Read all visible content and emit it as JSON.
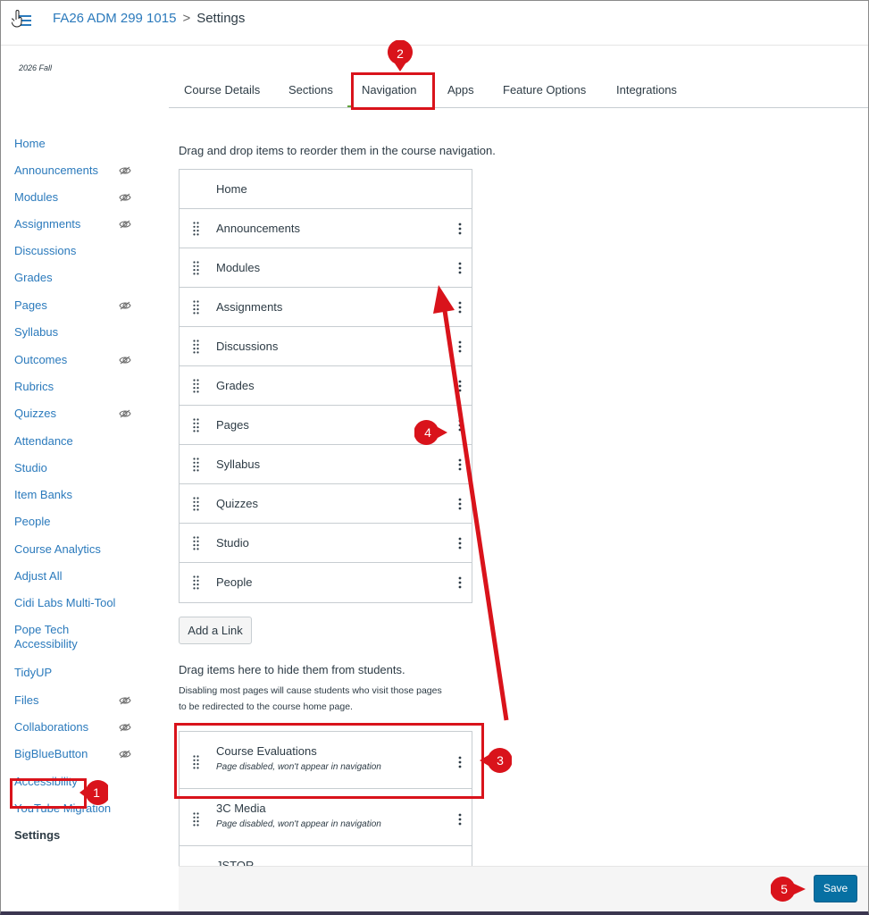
{
  "header": {
    "course": "FA26 ADM 299 1015",
    "separator": ">",
    "current": "Settings"
  },
  "sidebar": {
    "term": "2026 Fall",
    "items": [
      {
        "label": "Home",
        "hidden": false
      },
      {
        "label": "Announcements",
        "hidden": true
      },
      {
        "label": "Modules",
        "hidden": true
      },
      {
        "label": "Assignments",
        "hidden": true
      },
      {
        "label": "Discussions",
        "hidden": false
      },
      {
        "label": "Grades",
        "hidden": false
      },
      {
        "label": "Pages",
        "hidden": true
      },
      {
        "label": "Syllabus",
        "hidden": false
      },
      {
        "label": "Outcomes",
        "hidden": true
      },
      {
        "label": "Rubrics",
        "hidden": false
      },
      {
        "label": "Quizzes",
        "hidden": true
      },
      {
        "label": "Attendance",
        "hidden": false
      },
      {
        "label": "Studio",
        "hidden": false
      },
      {
        "label": "Item Banks",
        "hidden": false
      },
      {
        "label": "People",
        "hidden": false
      },
      {
        "label": "Course Analytics",
        "hidden": false
      },
      {
        "label": "Adjust All",
        "hidden": false
      },
      {
        "label": "Cidi Labs Multi-Tool",
        "hidden": false
      },
      {
        "label": "Pope Tech Accessibility",
        "hidden": false
      },
      {
        "label": "TidyUP",
        "hidden": false
      },
      {
        "label": "Files",
        "hidden": true
      },
      {
        "label": "Collaborations",
        "hidden": true
      },
      {
        "label": "BigBlueButton",
        "hidden": true
      },
      {
        "label": "Accessibility",
        "hidden": false
      },
      {
        "label": "YouTube Migration",
        "hidden": false
      },
      {
        "label": "Settings",
        "hidden": false
      }
    ]
  },
  "tabs": [
    "Course Details",
    "Sections",
    "Navigation",
    "Apps",
    "Feature Options",
    "Integrations"
  ],
  "active_tab": "Navigation",
  "instructions": "Drag and drop items to reorder them in the course navigation.",
  "enabled_items": [
    "Home",
    "Announcements",
    "Modules",
    "Assignments",
    "Discussions",
    "Grades",
    "Pages",
    "Syllabus",
    "Quizzes",
    "Studio",
    "People"
  ],
  "add_link_label": "Add a Link",
  "hidden_section": {
    "title": "Drag items here to hide them from students.",
    "note_line1": "Disabling most pages will cause students who visit those pages",
    "note_line2": "to be redirected to the course home page.",
    "items": [
      {
        "label": "Course Evaluations",
        "sub": "Page disabled, won't appear in navigation"
      },
      {
        "label": "3C Media",
        "sub": "Page disabled, won't appear in navigation"
      },
      {
        "label": "JSTOR",
        "sub": ""
      }
    ]
  },
  "save_label": "Save",
  "annotations": {
    "step1": "1",
    "step2": "2",
    "step3": "3",
    "step4": "4",
    "step5": "5",
    "color": "#d9131b"
  },
  "colors": {
    "link": "#2b7abc",
    "text": "#2d3b45",
    "save": "#0770a3"
  },
  "icons": {
    "hamburger": "hamburger-icon",
    "hidden": "eye-slash-icon",
    "drag": "drag-handle-icon",
    "menu": "kebab-menu-icon"
  }
}
